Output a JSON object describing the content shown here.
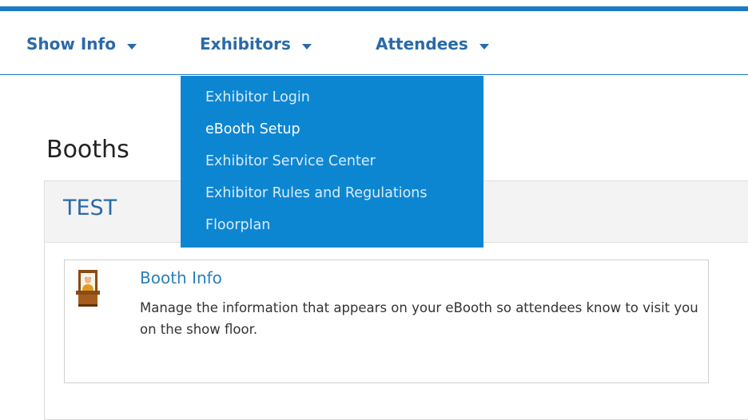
{
  "nav": {
    "items": [
      {
        "label": "Show Info",
        "icon": "caret-down-icon"
      },
      {
        "label": "Exhibitors",
        "icon": "caret-down-icon"
      },
      {
        "label": "Attendees",
        "icon": "caret-down-icon"
      }
    ],
    "accent_color": "#1b7bc4"
  },
  "dropdown": {
    "items": [
      {
        "label": "Exhibitor Login"
      },
      {
        "label": "eBooth Setup"
      },
      {
        "label": "Exhibitor Service Center"
      },
      {
        "label": "Exhibitor Rules and Regulations"
      },
      {
        "label": "Floorplan"
      }
    ],
    "background_color": "#0d86d2"
  },
  "page": {
    "title": "Booths"
  },
  "panel": {
    "title": "TEST"
  },
  "card": {
    "icon": "booth-icon",
    "title": "Booth Info",
    "description": "Manage the information that appears on your eBooth so attendees know to visit you on the show floor."
  }
}
